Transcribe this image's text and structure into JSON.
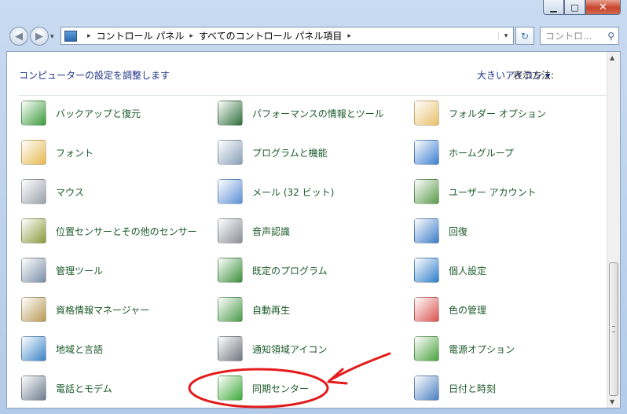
{
  "window": {
    "minimize_glyph": "▁",
    "maximize_glyph": "□",
    "close_glyph": "✕"
  },
  "nav": {
    "back_glyph": "◀",
    "forward_glyph": "▶",
    "recent_glyph": "▾"
  },
  "address": {
    "crumbs": [
      "コントロール パネル",
      "すべてのコントロール パネル項目"
    ],
    "separator": "▸",
    "dropdown_glyph": "▾"
  },
  "refresh_glyph": "↻",
  "search": {
    "placeholder": "コントロ...",
    "icon_glyph": "⚲"
  },
  "header": {
    "title": "コンピューターの設定を調整します",
    "view_label": "表示方法:",
    "view_value": "大きいアイコン ▾"
  },
  "items": [
    {
      "label": "バックアップと復元",
      "icon": "backup-restore-icon",
      "color": "#3a9a3a"
    },
    {
      "label": "パフォーマンスの情報とツール",
      "icon": "performance-icon",
      "color": "#2f6e3a"
    },
    {
      "label": "フォルダー オプション",
      "icon": "folder-options-icon",
      "color": "#e8c06a"
    },
    {
      "label": "フォント",
      "icon": "fonts-icon",
      "color": "#e6b84f"
    },
    {
      "label": "プログラムと機能",
      "icon": "programs-features-icon",
      "color": "#8aa0b8"
    },
    {
      "label": "ホームグループ",
      "icon": "homegroup-icon",
      "color": "#3d7fd0"
    },
    {
      "label": "マウス",
      "icon": "mouse-icon",
      "color": "#9aa1aa"
    },
    {
      "label": "メール (32 ビット)",
      "icon": "mail-icon",
      "color": "#5b8fd6"
    },
    {
      "label": "ユーザー アカウント",
      "icon": "user-accounts-icon",
      "color": "#5a9a4a"
    },
    {
      "label": "位置センサーとその他のセンサー",
      "icon": "location-sensors-icon",
      "color": "#8a9a3a"
    },
    {
      "label": "音声認識",
      "icon": "microphone-icon",
      "color": "#8a8f96"
    },
    {
      "label": "回復",
      "icon": "recovery-icon",
      "color": "#3c7cc8"
    },
    {
      "label": "管理ツール",
      "icon": "admin-tools-icon",
      "color": "#7b8fa8"
    },
    {
      "label": "既定のプログラム",
      "icon": "default-programs-icon",
      "color": "#3b8f3b"
    },
    {
      "label": "個人設定",
      "icon": "personalization-icon",
      "color": "#2e7fc9"
    },
    {
      "label": "資格情報マネージャー",
      "icon": "credential-manager-icon",
      "color": "#b89a55"
    },
    {
      "label": "自動再生",
      "icon": "autoplay-icon",
      "color": "#4a9a4a"
    },
    {
      "label": "色の管理",
      "icon": "color-management-icon",
      "color": "#d9534f"
    },
    {
      "label": "地域と言語",
      "icon": "region-language-icon",
      "color": "#3a84c9"
    },
    {
      "label": "通知領域アイコン",
      "icon": "notification-icons-icon",
      "color": "#6f7780"
    },
    {
      "label": "電源オプション",
      "icon": "power-options-icon",
      "color": "#4aa23f"
    },
    {
      "label": "電話とモデム",
      "icon": "phone-modem-icon",
      "color": "#6b7b8c"
    },
    {
      "label": "同期センター",
      "icon": "sync-center-icon",
      "color": "#3faa3a"
    },
    {
      "label": "日付と時刻",
      "icon": "date-time-icon",
      "color": "#4a7fc0"
    }
  ],
  "annotation_color": "#e31b1b"
}
